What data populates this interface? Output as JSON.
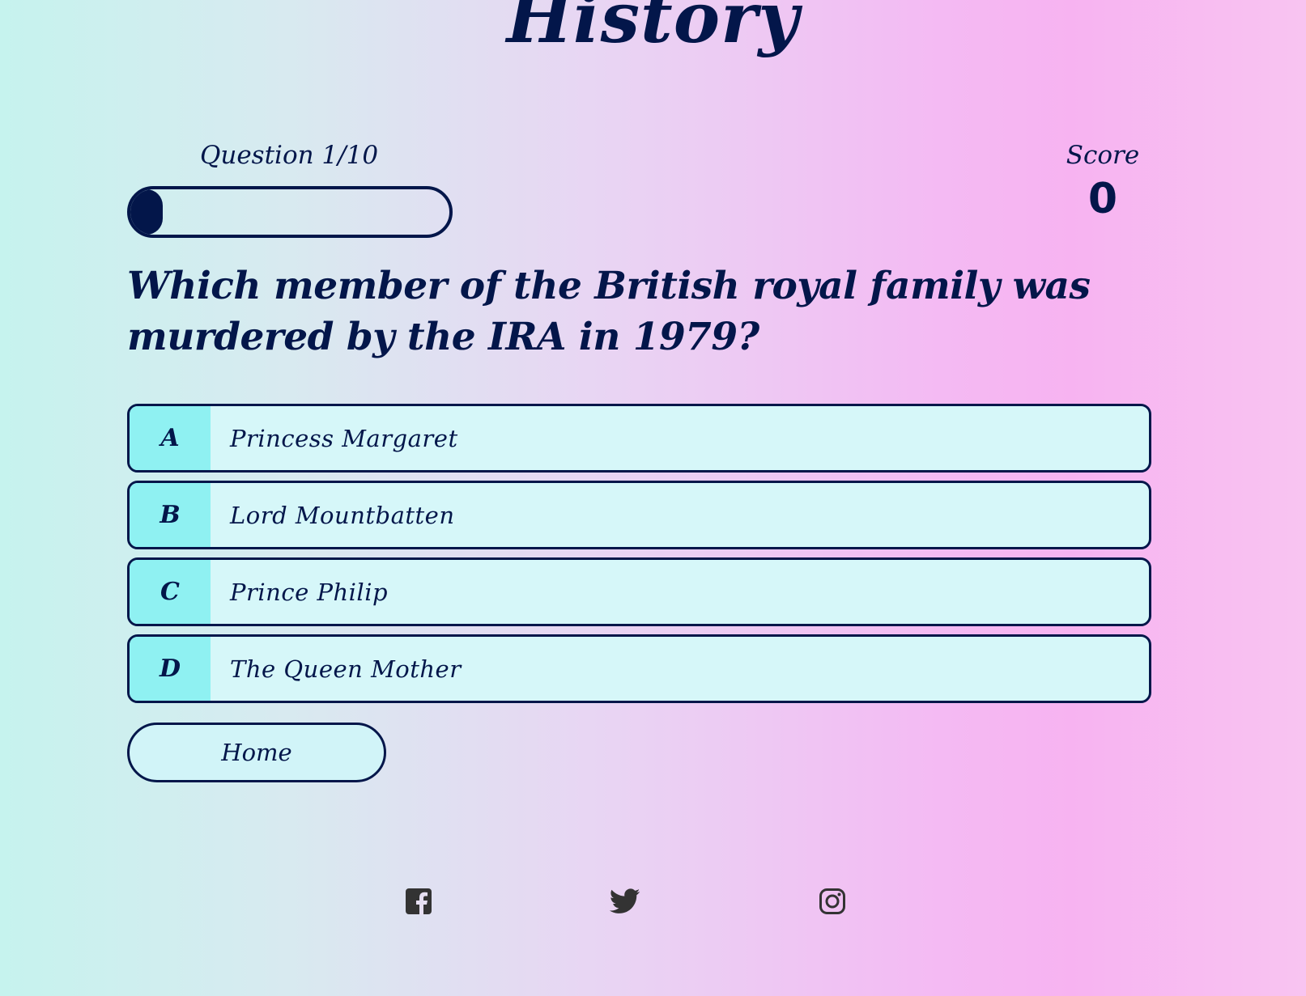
{
  "page": {
    "title": "History"
  },
  "hud": {
    "progress_text": "Question 1/10",
    "progress_fraction": 0.1,
    "score_label": "Score",
    "score_value": "0"
  },
  "question": {
    "text": "Which member of the British royal family was murdered by the IRA in 1979?"
  },
  "choices": [
    {
      "prefix": "A",
      "text": "Princess Margaret"
    },
    {
      "prefix": "B",
      "text": "Lord Mountbatten"
    },
    {
      "prefix": "C",
      "text": "Prince Philip"
    },
    {
      "prefix": "D",
      "text": "The Queen Mother"
    }
  ],
  "home_button": {
    "label": "Home"
  },
  "social_icons": [
    "facebook-icon",
    "twitter-icon",
    "instagram-icon"
  ],
  "colors": {
    "primary": "#03164a",
    "choice_bg": "#d6f7f9",
    "prefix_bg": "#8ff1f2",
    "social_icon": "#333333"
  }
}
